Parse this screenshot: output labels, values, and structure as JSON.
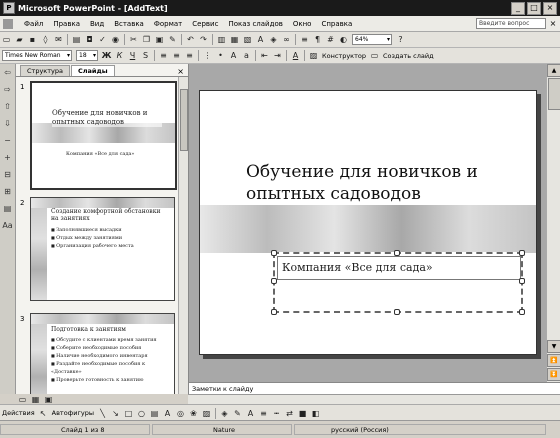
{
  "window": {
    "title": "Microsoft PowerPoint - [AddText]",
    "min": "_",
    "max": "□",
    "close": "×"
  },
  "menu": {
    "items": [
      "Файл",
      "Правка",
      "Вид",
      "Вставка",
      "Формат",
      "Сервис",
      "Показ слайдов",
      "Окно",
      "Справка"
    ],
    "help_placeholder": "Введите вопрос",
    "close": "×"
  },
  "toolbar_standard": {
    "zoom": "64%",
    "help": "?"
  },
  "toolbar_format": {
    "font": "Times New Roman",
    "size": "18",
    "bold": "Ж",
    "italic": "К",
    "underline": "Ч",
    "shadow": "S",
    "font_color": "A",
    "designer": "Конструктор",
    "new_slide": "Создать слайд"
  },
  "panel": {
    "tab_outline": "Структура",
    "tab_slides": "Слайды",
    "close": "×",
    "slides": [
      {
        "num": "1",
        "title": "Обучение для новичков и опытных садоводов",
        "subtitle": "Компания «Все для сада»"
      },
      {
        "num": "2",
        "title": "Создание комфортной обстановки на занятиях",
        "bullets": [
          "Заполнявшиеся высадки",
          "Отдых между занятиями",
          "Организация рабочего места"
        ]
      },
      {
        "num": "3",
        "title": "Подготовка к занятиям",
        "bullets": [
          "Обсудите с клиентами время занятия",
          "Соберите необходимые пособия",
          "Наличие необходимого инвентаря",
          "Раздайте необходимые пособия к «Доставке»",
          "Проверьте готовность к занятию"
        ]
      }
    ]
  },
  "slide": {
    "title": "Обучение для новичков и опытных садоводов",
    "subtitle": "Компания «Все для сада»"
  },
  "notes": {
    "placeholder": "Заметки к слайду"
  },
  "drawing": {
    "actions": "Действия",
    "autoshapes": "Автофигуры"
  },
  "status": {
    "slide": "Слайд 1 из 8",
    "design": "Nature",
    "language": "русский (Россия)"
  }
}
